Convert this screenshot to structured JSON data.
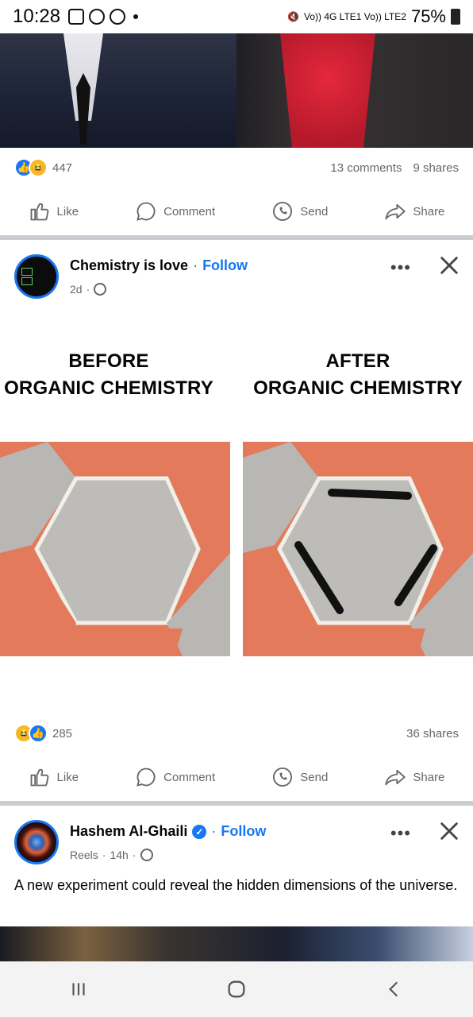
{
  "status_bar": {
    "time": "10:28",
    "network": "Vo)) 4G LTE1  Vo)) LTE2",
    "battery": "75%"
  },
  "post1": {
    "reaction_count": "447",
    "comments": "13 comments",
    "shares": "9 shares"
  },
  "actions": {
    "like": "Like",
    "comment": "Comment",
    "send": "Send",
    "share": "Share"
  },
  "post2": {
    "author": "Chemistry is love",
    "follow": "Follow",
    "age": "2d",
    "avatar_text": "love Chemistry",
    "meme_left_line1": "BEFORE",
    "meme_left_line2": "ORGANIC CHEMISTRY",
    "meme_right_line1": "AFTER",
    "meme_right_line2": "ORGANIC CHEMISTRY",
    "reaction_count": "285",
    "shares": "36 shares"
  },
  "post3": {
    "author": "Hashem Al-Ghaili",
    "follow": "Follow",
    "source": "Reels",
    "age": "14h",
    "text": "A new experiment could reveal the hidden dimensions of the universe."
  },
  "icons": [
    "like-icon",
    "comment-icon",
    "send-icon",
    "share-icon",
    "globe-icon",
    "close-icon",
    "more-icon",
    "verified-icon"
  ],
  "colors": {
    "accent": "#1877f2",
    "secondary_text": "#65676b",
    "tile_orange": "#e37a5c",
    "tile_grey": "#bdbcb8"
  }
}
